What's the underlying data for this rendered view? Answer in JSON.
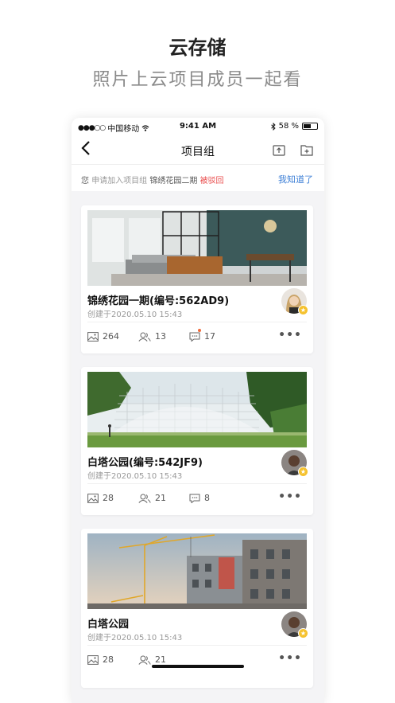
{
  "hero": {
    "title": "云存储",
    "subtitle": "照片上云项目成员一起看"
  },
  "status_bar": {
    "signal": "●●●○○",
    "carrier": "中国移动",
    "time": "9:41 AM",
    "battery": "58 %",
    "battery_level": 0.58
  },
  "nav": {
    "back_icon": "chevron-left-icon",
    "title": "项目组",
    "upload_icon": "upload-icon",
    "add_icon": "add-folder-icon"
  },
  "notice": {
    "subject": "您",
    "action": "申请加入项目组",
    "project": "锦绣花园二期",
    "status": "被驳回",
    "ack": "我知道了"
  },
  "projects": [
    {
      "name": "锦绣花园一期",
      "code": "(编号:562AD9)",
      "created": "创建于2020.05.10  15:43",
      "photos": "264",
      "members": "13",
      "comments": "17",
      "has_unread": true
    },
    {
      "name": "白塔公园",
      "code": "(编号:542JF9)",
      "created": "创建于2020.05.10  15:43",
      "photos": "28",
      "members": "21",
      "comments": "8",
      "has_unread": false
    },
    {
      "name": "白塔公园",
      "code": "",
      "created": "创建于2020.05.10  15:43",
      "photos": "28",
      "members": "21",
      "comments": "",
      "has_unread": false
    }
  ],
  "more_label": "•••",
  "colors": {
    "accent_blue": "#3b7ed6",
    "reject_red": "#e94b4b",
    "owner_badge": "#f5c22f"
  }
}
